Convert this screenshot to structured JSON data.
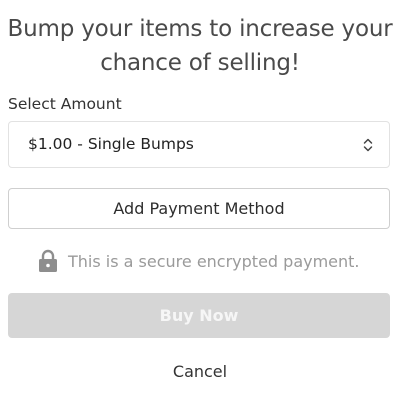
{
  "dialog": {
    "headline": "Bump your items to increase your chance of selling!"
  },
  "amount": {
    "label": "Select Amount",
    "selected": "$1.00 - Single Bumps",
    "chevron_icon": "up-down-chevron-icon"
  },
  "payment": {
    "add_label": "Add Payment Method"
  },
  "secure": {
    "icon": "lock-icon",
    "text": "This is a secure encrypted payment."
  },
  "actions": {
    "buy_label": "Buy Now",
    "buy_state": "disabled",
    "cancel_label": "Cancel"
  },
  "colors": {
    "buy_disabled_bg": "#d6d6d6",
    "muted_text": "#9a9a9a",
    "border": "#cfcfcf"
  }
}
